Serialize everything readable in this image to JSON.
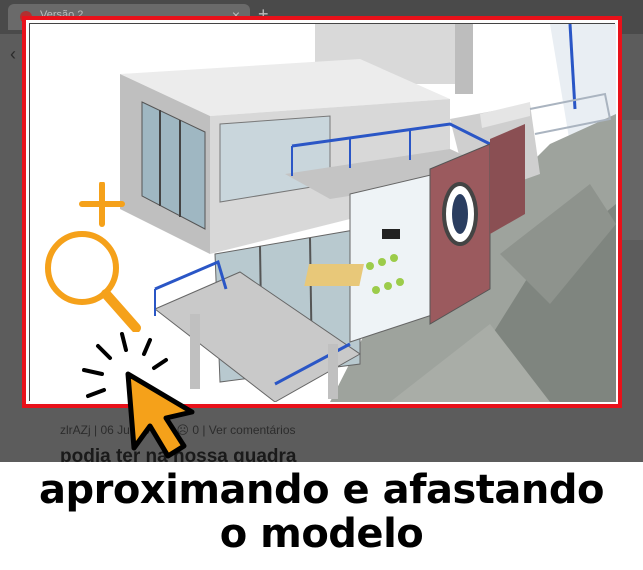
{
  "browser": {
    "tab_title": "Versão 2",
    "tab_close": "×",
    "new_tab": "+",
    "back_glyph": "‹"
  },
  "post": {
    "meta": "zlrAZj | 06 Junho ... 0 ☹ 0 | Ver comentários",
    "title_partial": "podia ter na nossa quadra"
  },
  "caption": {
    "line1": "aproximando e afastando",
    "line2": "o modelo"
  },
  "colors": {
    "highlight_border": "#e8111a",
    "zoom_icon": "#f5a11a",
    "cursor_fill": "#f5a11a",
    "railing": "#2a56c6",
    "accent_wall": "#9b5a5e"
  },
  "icons": {
    "zoom": "zoom-in-magnifier-icon",
    "cursor": "click-pointer-icon"
  }
}
